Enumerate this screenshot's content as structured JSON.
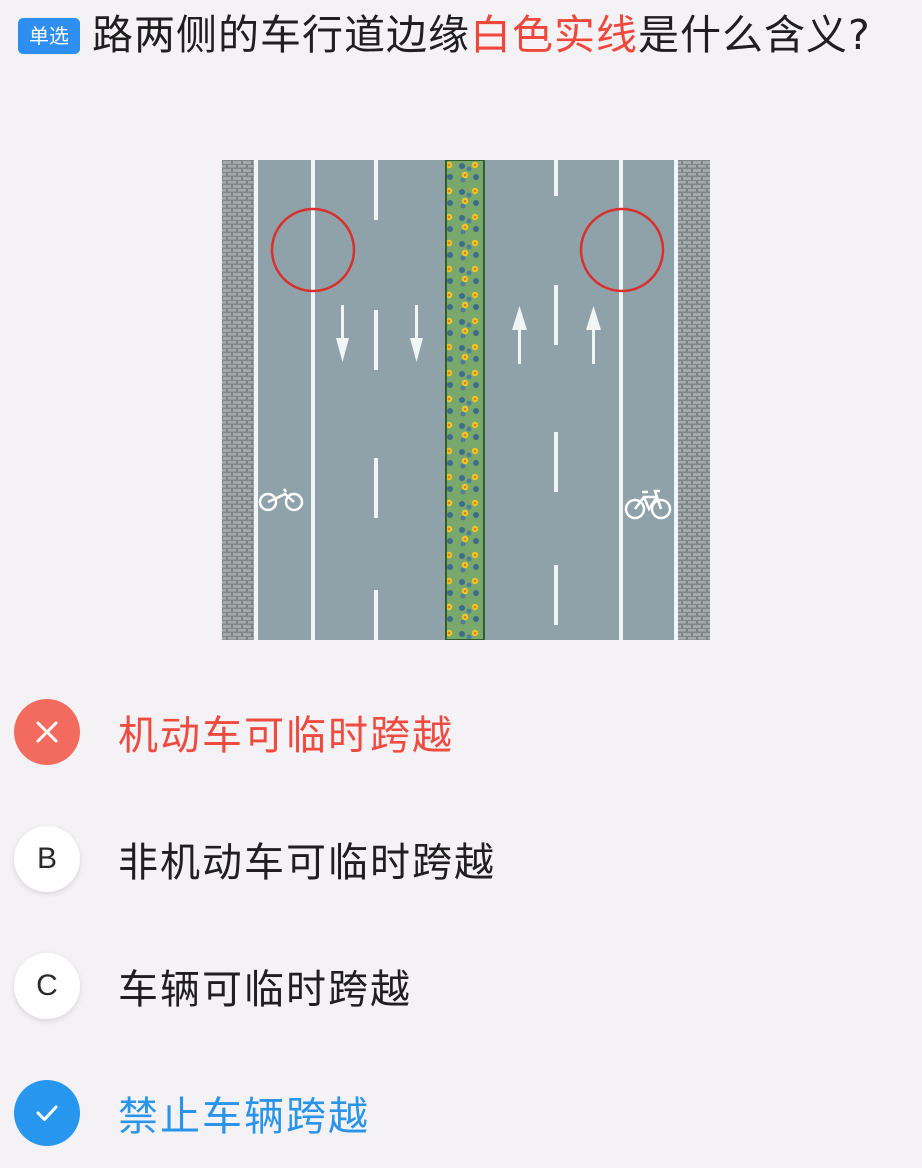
{
  "question": {
    "tag": "单选",
    "text_before": "路两侧的车行道边缘",
    "highlight": "白色实线",
    "text_after": "是什么含义?"
  },
  "options": [
    {
      "badge": "",
      "text": "机动车可临时跨越",
      "state": "wrong",
      "icon": "close-icon"
    },
    {
      "badge": "B",
      "text": "非机动车可临时跨越",
      "state": "normal"
    },
    {
      "badge": "C",
      "text": "车辆可临时跨越",
      "state": "normal"
    },
    {
      "badge": "",
      "text": "禁止车辆跨越",
      "state": "correct",
      "icon": "check-icon"
    }
  ],
  "colors": {
    "accent_blue": "#2f8ff0",
    "wrong_red": "#f36a5e",
    "highlight_red": "#f0473d",
    "road_gray": "#8fa2aa"
  }
}
